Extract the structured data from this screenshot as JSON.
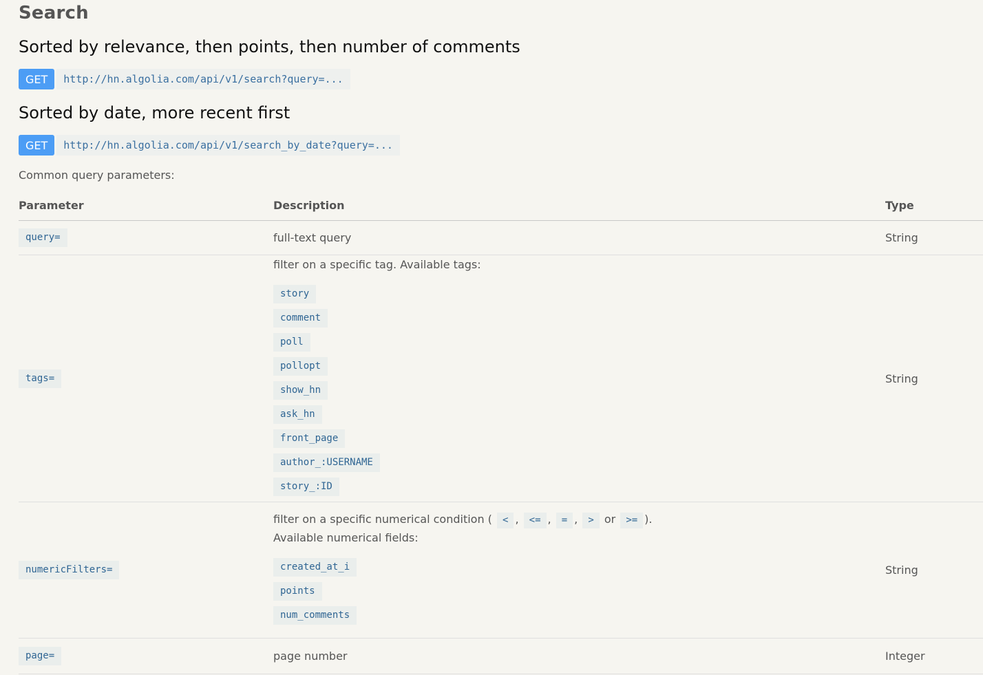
{
  "section_title": "Search",
  "endpoints": [
    {
      "title": "Sorted by relevance, then points, then number of comments",
      "method": "GET",
      "url": "http://hn.algolia.com/api/v1/search?query=..."
    },
    {
      "title": "Sorted by date, more recent first",
      "method": "GET",
      "url": "http://hn.algolia.com/api/v1/search_by_date?query=..."
    }
  ],
  "common_label": "Common query parameters:",
  "table": {
    "headers": {
      "parameter": "Parameter",
      "description": "Description",
      "type": "Type"
    },
    "rows": [
      {
        "param": "query=",
        "description": "full-text query",
        "type": "String"
      },
      {
        "param": "tags=",
        "description": "filter on a specific tag. Available tags:",
        "items": [
          "story",
          "comment",
          "poll",
          "pollopt",
          "show_hn",
          "ask_hn",
          "front_page",
          "author_:USERNAME",
          "story_:ID"
        ],
        "type": "String"
      },
      {
        "param": "numericFilters=",
        "description_prefix": "filter on a specific numerical condition (",
        "operators": [
          "<",
          "<=",
          "=",
          ">",
          ">="
        ],
        "sep_comma": ",",
        "sep_or": "or",
        "description_suffix": ").",
        "description_line2": "Available numerical fields:",
        "items": [
          "created_at_i",
          "points",
          "num_comments"
        ],
        "type": "String"
      },
      {
        "param": "page=",
        "description": "page number",
        "type": "Integer"
      }
    ]
  }
}
